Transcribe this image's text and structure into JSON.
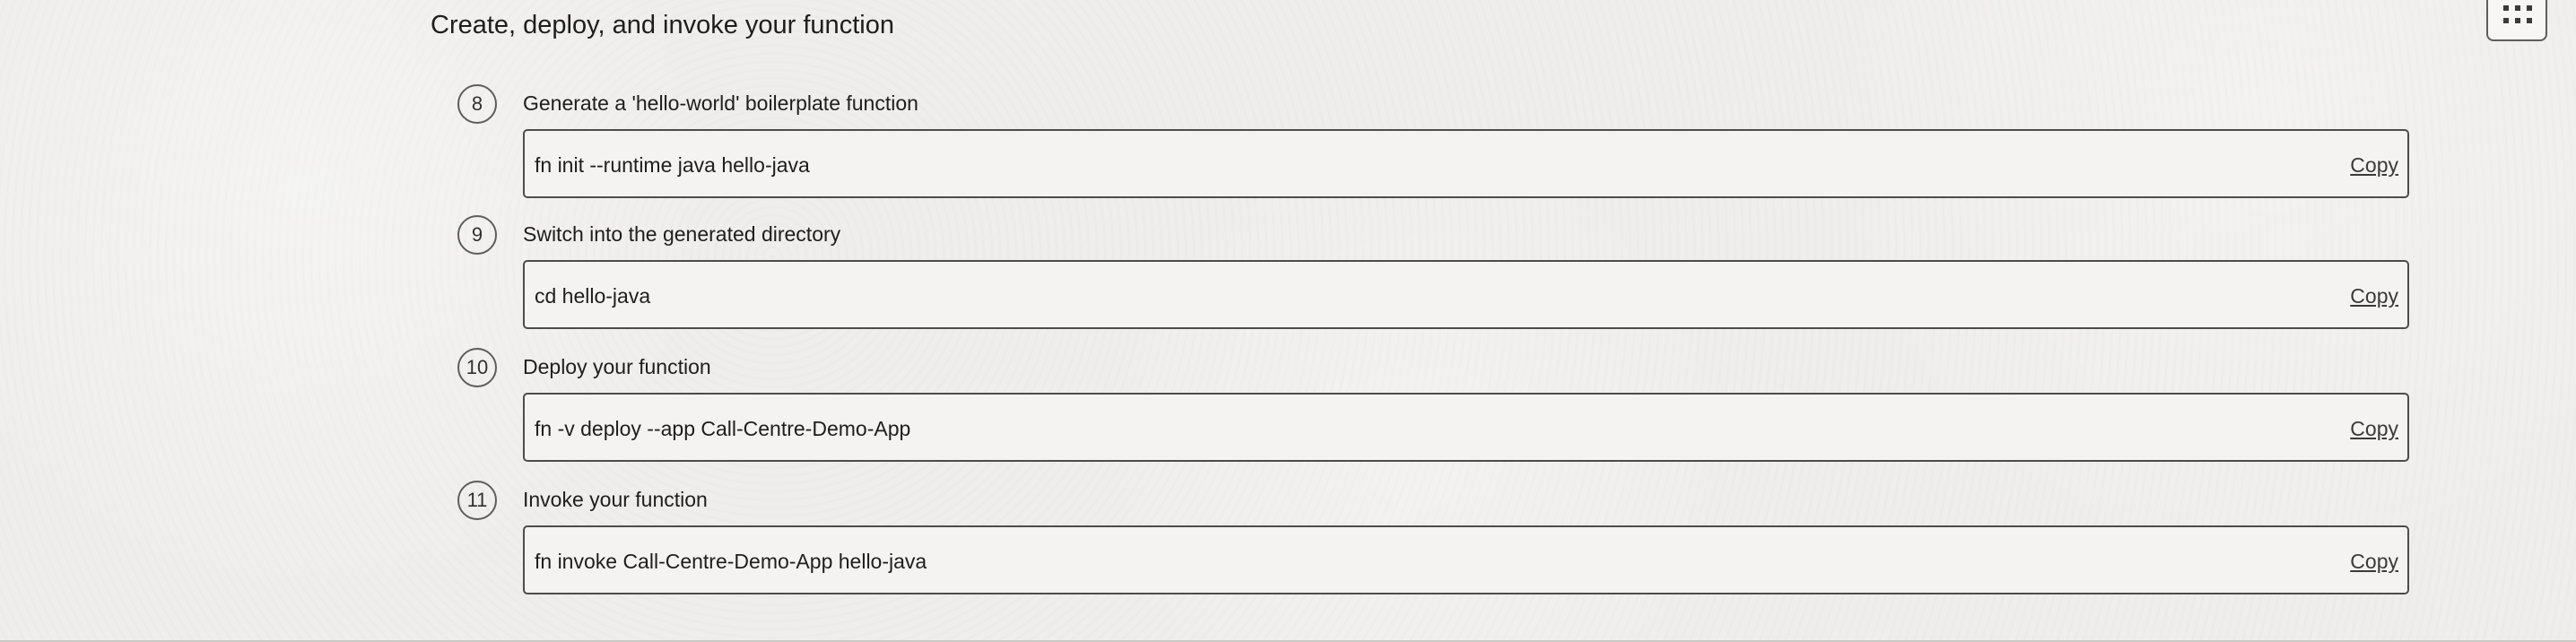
{
  "section": {
    "title": "Create, deploy, and invoke your function"
  },
  "steps": [
    {
      "number": "8",
      "label": "Generate a 'hello-world' boilerplate function",
      "command": "fn init --runtime java hello-java",
      "copy_label": "Copy"
    },
    {
      "number": "9",
      "label": "Switch into the generated directory",
      "command": "cd hello-java",
      "copy_label": "Copy"
    },
    {
      "number": "10",
      "label": "Deploy your function",
      "command": "fn -v deploy --app Call-Centre-Demo-App",
      "copy_label": "Copy"
    },
    {
      "number": "11",
      "label": "Invoke your function",
      "command": "fn invoke Call-Centre-Demo-App hello-java",
      "copy_label": "Copy"
    }
  ],
  "toolbar": {
    "apps_icon": "apps-grid-icon"
  },
  "colors": {
    "background": "#efeeec",
    "box_background": "#f4f3f1",
    "border": "#4c4c4c",
    "text": "#1e1e1e"
  }
}
